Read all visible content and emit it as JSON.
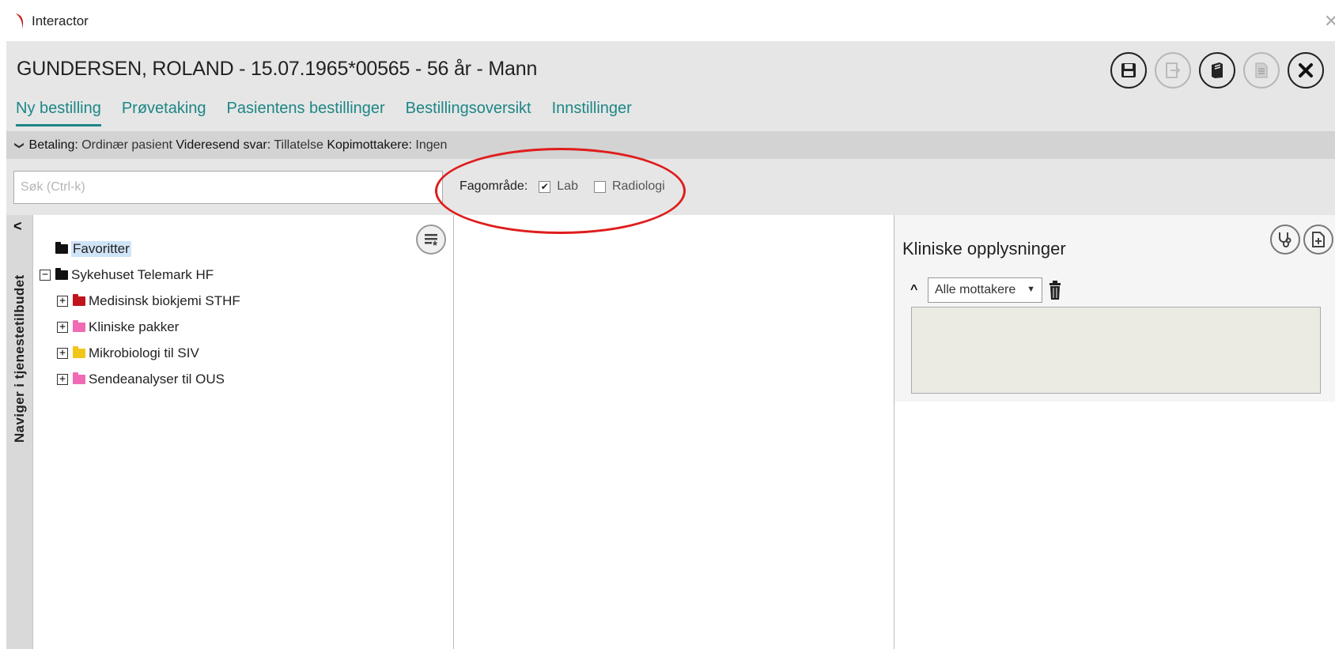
{
  "window": {
    "title": "Interactor",
    "close_glyph": "✕"
  },
  "patient": {
    "header": "GUNDERSEN, ROLAND - 15.07.1965*00565 - 56 år - Mann"
  },
  "tabs": [
    {
      "label": "Ny bestilling",
      "active": true
    },
    {
      "label": "Prøvetaking"
    },
    {
      "label": "Pasientens bestillinger"
    },
    {
      "label": "Bestillingsoversikt"
    },
    {
      "label": "Innstillinger"
    }
  ],
  "header_icons": [
    "save-icon",
    "export-icon",
    "book-icon",
    "document-icon",
    "close-icon"
  ],
  "info": {
    "chevron": "❯",
    "betaling_label": "Betaling:",
    "betaling_value": "Ordinær pasient",
    "videresend_label": "Videresend svar:",
    "videresend_value": "Tillatelse",
    "kopi_label": "Kopimottakere:",
    "kopi_value": "Ingen"
  },
  "search": {
    "placeholder": "Søk (Ctrl-k)",
    "value": ""
  },
  "fagomrade": {
    "label": "Fagområde:",
    "options": [
      {
        "label": "Lab",
        "checked": true
      },
      {
        "label": "Radiologi",
        "checked": false
      }
    ]
  },
  "sidenav": {
    "label": "Naviger i tjenestetilbudet",
    "collapse_glyph": "<"
  },
  "tree": {
    "favorites": "Favoritter",
    "root": {
      "label": "Sykehuset Telemark HF",
      "expander": "−"
    },
    "children": [
      {
        "label": "Medisinsk biokjemi STHF",
        "color": "#c0141c",
        "expander": "+"
      },
      {
        "label": "Kliniske pakker",
        "color": "#f06bb4",
        "expander": "+"
      },
      {
        "label": "Mikrobiologi til SIV",
        "color": "#f2c51a",
        "expander": "+"
      },
      {
        "label": "Sendeanalyser til OUS",
        "color": "#f06bb4",
        "expander": "+"
      }
    ]
  },
  "clinical": {
    "title": "Kliniske opplysninger",
    "collapse_glyph": "^",
    "recipient": "Alle mottakere",
    "dropdown_glyph": "▼",
    "note": "",
    "icons": [
      "stethoscope-icon",
      "add-document-icon"
    ]
  },
  "colors": {
    "accent": "#1e8686",
    "highlight_ring": "#e01c1c",
    "header_bg": "#e6e6e6"
  }
}
